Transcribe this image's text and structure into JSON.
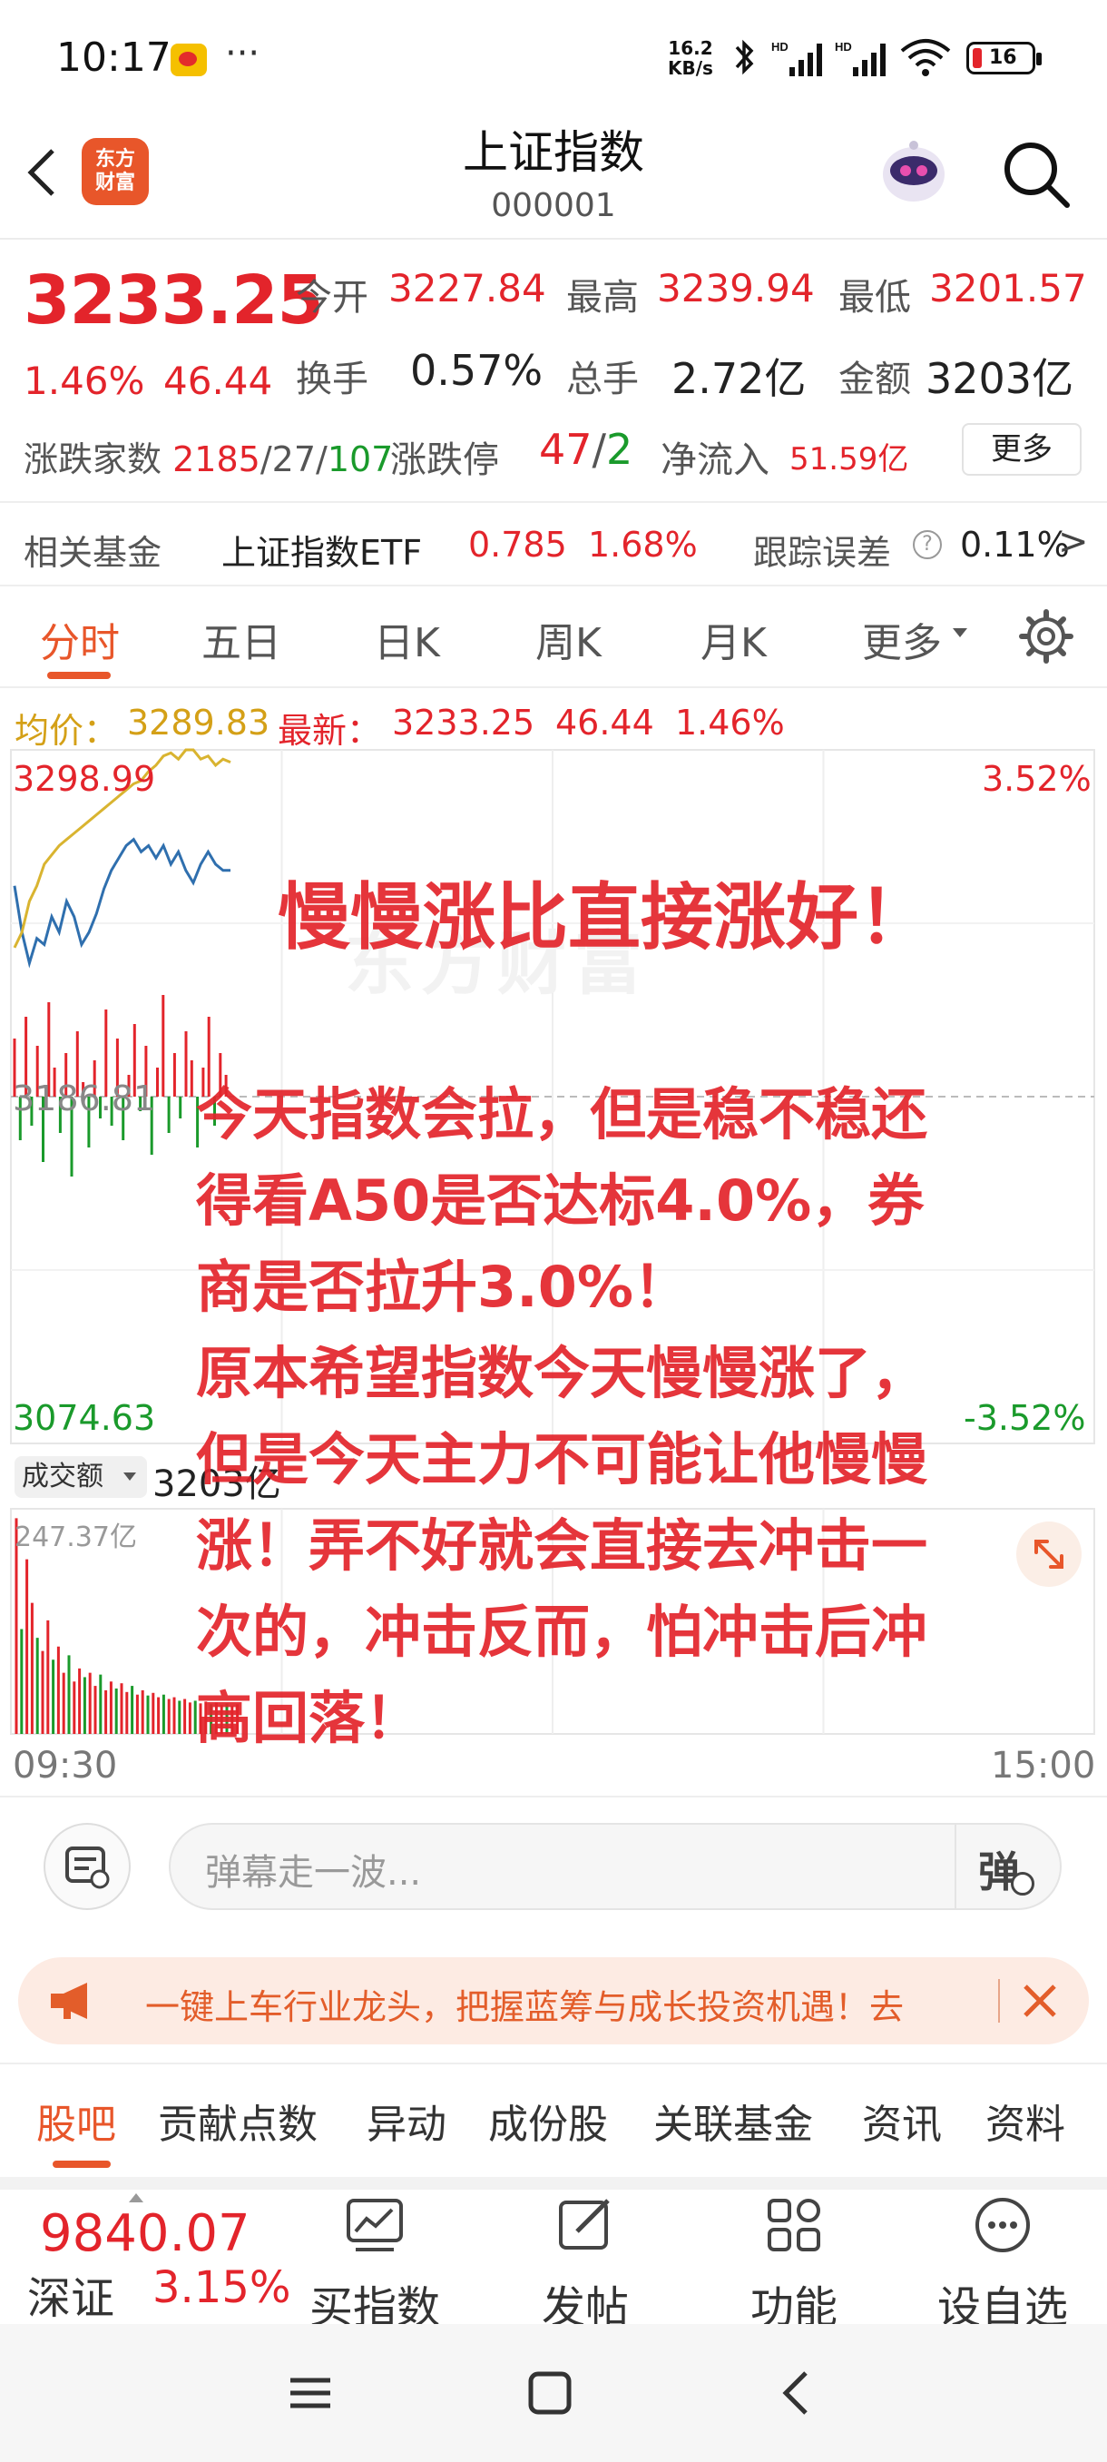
{
  "status_bar": {
    "time": "10:17",
    "more": "···",
    "net_speed_value": "16.2",
    "net_speed_unit": "KB/s",
    "battery": "16"
  },
  "header": {
    "logo_line1": "东方",
    "logo_line2": "财富",
    "title": "上证指数",
    "code": "000001"
  },
  "quote": {
    "price": "3233.25",
    "change_pct": "1.46%",
    "change": "46.44",
    "open_label": "今开",
    "open": "3227.84",
    "high_label": "最高",
    "high": "3239.94",
    "low_label": "最低",
    "low": "3201.57",
    "turnover_label": "换手",
    "turnover": "0.57%",
    "volume_label": "总手",
    "volume": "2.72亿",
    "amount_label": "金额",
    "amount": "3203亿",
    "advdec_label": "涨跌家数",
    "advances": "2185",
    "unchanged": "27",
    "declines": "107",
    "limit_label": "涨跌停",
    "limit_up": "47",
    "limit_down": "2",
    "netflow_label": "净流入",
    "netflow": "51.59亿",
    "more_label": "更多"
  },
  "fund": {
    "label": "相关基金",
    "name": "上证指数ETF",
    "price": "0.785",
    "pct": "1.68%",
    "track_label": "跟踪误差",
    "track_value": "0.11%",
    "arrow": ">"
  },
  "tabs": [
    "分时",
    "五日",
    "日K",
    "周K",
    "月K",
    "更多"
  ],
  "chart_header": {
    "avg_label": "均价：",
    "avg": "3289.83",
    "last_label": "最新：",
    "last": "3233.25",
    "change": "46.44",
    "pct": "1.46%"
  },
  "chart_labels": {
    "high": "3298.99",
    "high_pct": "3.52%",
    "prev_close": "3186.81",
    "low": "3074.63",
    "low_pct": "-3.52%",
    "watermark": "东方财富",
    "vol_select": "成交额",
    "vol_value": "3203亿",
    "vol_max": "247.37亿",
    "time_start": "09:30",
    "time_end": "15:00"
  },
  "chart_data": {
    "type": "line",
    "x_range": [
      "09:30",
      "15:00"
    ],
    "ylim": [
      3074.63,
      3298.99
    ],
    "prev_close": 3186.81,
    "series": [
      {
        "name": "最新",
        "color": "#2f6fae",
        "values": [
          3255,
          3240,
          3230,
          3238,
          3236,
          3245,
          3240,
          3250,
          3245,
          3236,
          3240,
          3246,
          3254,
          3260,
          3264,
          3268,
          3270,
          3266,
          3268,
          3264,
          3268,
          3262,
          3266,
          3260,
          3256,
          3262,
          3266,
          3262,
          3260,
          3260
        ]
      },
      {
        "name": "均价",
        "color": "#d9b430",
        "values": [
          3235,
          3240,
          3250,
          3255,
          3262,
          3265,
          3268,
          3270,
          3272,
          3274,
          3276,
          3278,
          3280,
          3282,
          3284,
          3286,
          3288,
          3289,
          3292,
          3294,
          3297,
          3298,
          3296,
          3299,
          3299,
          3296,
          3297,
          3294,
          3296,
          3295
        ]
      }
    ],
    "volume_max": 247.37,
    "volume": [
      247,
      120,
      200,
      150,
      110,
      95,
      130,
      85,
      100,
      70,
      90,
      60,
      75,
      65,
      70,
      55,
      68,
      50,
      60,
      52,
      58,
      48,
      55,
      45,
      50,
      44,
      47,
      42,
      45,
      40,
      42,
      38,
      40,
      36,
      38,
      35,
      37,
      34,
      36,
      33,
      35,
      32,
      34
    ],
    "bars": [
      40,
      -30,
      55,
      -20,
      35,
      -45,
      65,
      20,
      -25,
      30,
      -55,
      45,
      10,
      -35,
      25,
      -15,
      60,
      -20,
      40,
      -30,
      15,
      50,
      -10,
      35,
      -40,
      20,
      70,
      -25,
      30,
      -15,
      45,
      25,
      -35,
      20,
      55,
      -20,
      30,
      15
    ]
  },
  "overlay": {
    "headline": "慢慢涨比直接涨好！",
    "lines": [
      "今天指数会拉，但是稳不稳还",
      "得看A50是否达标4.0%，券",
      "商是否拉升3.0%！",
      "原本希望指数今天慢慢涨了，",
      "但是今天主力不可能让他慢慢",
      "涨！弄不好就会直接去冲击一",
      "次的，冲击反而，怕冲击后冲",
      "高回落！"
    ]
  },
  "danmaku": {
    "placeholder": "弹幕走一波...",
    "toggle": "弹"
  },
  "promo": {
    "text": "一键上车行业龙头，把握蓝筹与成长投资机遇！去"
  },
  "bottom_tabs": [
    "股吧",
    "贡献点数",
    "异动",
    "成份股",
    "关联基金",
    "资讯",
    "资料"
  ],
  "bottom_bar": {
    "sz_price": "9840.07",
    "sz_name": "深证",
    "sz_pct": "3.15%",
    "buy": "买指数",
    "post": "发帖",
    "func": "功能",
    "watch": "设自选"
  }
}
